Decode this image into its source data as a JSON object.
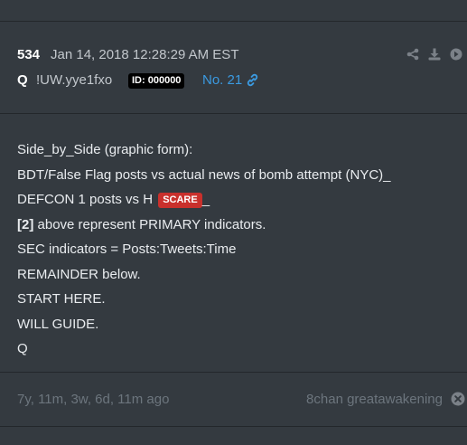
{
  "post": {
    "number": "534",
    "date": "Jan 14, 2018 12:28:29 AM EST",
    "author": "Q",
    "tripcode": "!UW.yye1fxo",
    "id_label": "ID: 000000",
    "post_link": "No. 21",
    "actions": [
      "share-icon",
      "download-icon",
      "arrow-right-icon"
    ]
  },
  "body": {
    "line1": "Side_by_Side (graphic form):",
    "line2": "BDT/False Flag posts vs actual news of bomb attempt (NYC)_",
    "line3_text": "DEFCON 1 posts vs H",
    "line3_tag": "SCARE",
    "line3_tail": "_",
    "line4_bold": "[2]",
    "line4_text": " above represent PRIMARY indicators.",
    "line5": "SEC indicators = Posts:Tweets:Time",
    "line6": "REMAINDER below.",
    "line7": "START HERE.",
    "line8": "WILL GUIDE.",
    "line9": "Q"
  },
  "footer": {
    "ago": "7y, 11m, 3w, 6d, 11m ago",
    "source": "8chan greatawakening",
    "close_icon": "close-circle-icon"
  },
  "colors": {
    "background": "#343a40",
    "link": "#3b9ae1",
    "tag": "#c9302c",
    "muted": "#6c757d"
  }
}
